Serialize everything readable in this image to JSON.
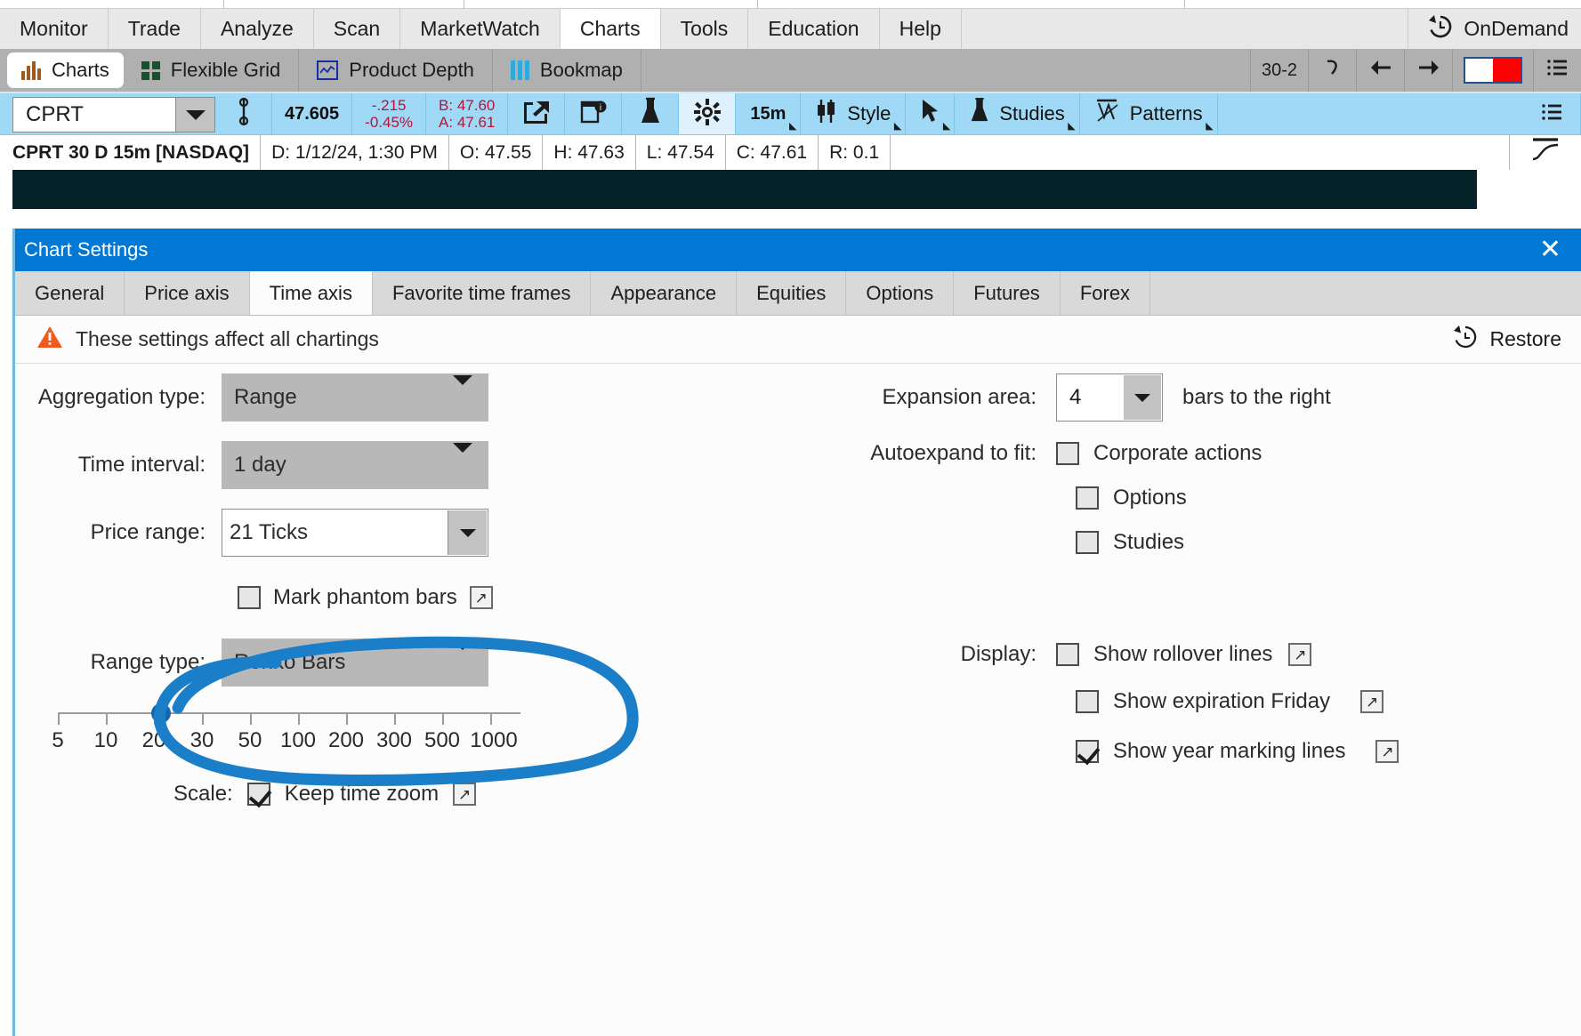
{
  "app": {
    "menu": [
      {
        "label": "Monitor",
        "active": false
      },
      {
        "label": "Trade",
        "active": false
      },
      {
        "label": "Analyze",
        "active": false
      },
      {
        "label": "Scan",
        "active": false
      },
      {
        "label": "MarketWatch",
        "active": false
      },
      {
        "label": "Charts",
        "active": true
      },
      {
        "label": "Tools",
        "active": false
      },
      {
        "label": "Education",
        "active": false
      },
      {
        "label": "Help",
        "active": false
      }
    ],
    "ondemand_label": "OnDemand",
    "ondemand_icon": "ondemand-clock-icon"
  },
  "toolbar": {
    "items": [
      {
        "label": "Charts",
        "icon": "bar-chart-icon",
        "selected": true
      },
      {
        "label": "Flexible Grid",
        "icon": "grid-icon",
        "selected": false
      },
      {
        "label": "Product Depth",
        "icon": "product-depth-icon",
        "selected": false
      },
      {
        "label": "Bookmap",
        "icon": "bookmap-icon",
        "selected": false
      }
    ],
    "grid_label": "30-2",
    "undo_icon": "undo-icon",
    "back_icon": "arrow-left-icon",
    "forward_icon": "arrow-right-icon",
    "swatch_left_color": "#ffffff",
    "swatch_right_color": "#ff0000",
    "menu_icon": "hamburger-menu-icon"
  },
  "symbar": {
    "symbol": "CPRT",
    "last_price": "47.605",
    "change_abs": "-.215",
    "change_pct": "-0.45%",
    "bid": "B: 47.60",
    "ask": "A: 47.61",
    "share_icon": "share-icon",
    "note_icon": "note-info-icon",
    "flask_icon": "flask-icon",
    "gear_icon": "gear-icon",
    "timeframe": "15m",
    "style_label": "Style",
    "drawing_label": "",
    "studies_label": "Studies",
    "patterns_label": "Patterns",
    "right_menu_icon": "hamburger-menu-icon"
  },
  "infobar": {
    "title": "CPRT 30 D 15m [NASDAQ]",
    "fields": [
      "D: 1/12/24, 1:30 PM",
      "O: 47.55",
      "H: 47.63",
      "L: 47.54",
      "C: 47.61",
      "R: 0.1"
    ],
    "right_icon": "curve-tool-icon"
  },
  "dialog": {
    "title": "Chart Settings",
    "close_icon": "close-icon",
    "title_bg": "#0078d4",
    "tabs": [
      {
        "label": "General",
        "active": false
      },
      {
        "label": "Price axis",
        "active": false
      },
      {
        "label": "Time axis",
        "active": true
      },
      {
        "label": "Favorite time frames",
        "active": false
      },
      {
        "label": "Appearance",
        "active": false
      },
      {
        "label": "Equities",
        "active": false
      },
      {
        "label": "Options",
        "active": false
      },
      {
        "label": "Futures",
        "active": false
      },
      {
        "label": "Forex",
        "active": false
      }
    ],
    "warning": {
      "icon": "warning-triangle-icon",
      "text": "These settings affect all chartings",
      "color": "#f05a1e"
    },
    "restore": {
      "label": "Restore",
      "icon": "restore-clock-icon"
    },
    "left": {
      "aggregation_type": {
        "label": "Aggregation type:",
        "value": "Range"
      },
      "time_interval": {
        "label": "Time interval:",
        "value": "1 day"
      },
      "price_range": {
        "label": "Price range:",
        "value": "21 Ticks"
      },
      "mark_phantom_bars": {
        "label": "Mark phantom bars",
        "checked": false,
        "popout": "↗"
      },
      "range_type": {
        "label": "Range type:",
        "value": "Renko Bars"
      },
      "slider": {
        "ticks": [
          "5",
          "10",
          "20",
          "30",
          "50",
          "100",
          "200",
          "300",
          "500",
          "1000"
        ],
        "value": "20"
      },
      "scale": {
        "label": "Scale:",
        "option_label": "Keep time zoom",
        "checked": true,
        "popout": "↗"
      }
    },
    "right": {
      "expansion_area": {
        "label": "Expansion area:",
        "value": "4",
        "suffix": "bars to the right"
      },
      "autoexpand": {
        "label": "Autoexpand to fit:",
        "options": [
          {
            "label": "Corporate actions",
            "checked": false,
            "popout": ""
          },
          {
            "label": "Options",
            "checked": false,
            "popout": ""
          },
          {
            "label": "Studies",
            "checked": false,
            "popout": ""
          }
        ]
      },
      "display": {
        "label": "Display:",
        "options": [
          {
            "label": "Show rollover lines",
            "checked": false,
            "popout": "↗"
          },
          {
            "label": "Show expiration Friday",
            "checked": false,
            "popout": "↗"
          },
          {
            "label": "Show year marking lines",
            "checked": true,
            "popout": "↗"
          }
        ]
      }
    }
  },
  "annotation": {
    "color": "#1a7ec8",
    "shape": "hand-drawn-ellipse",
    "target": "range-type-row"
  }
}
